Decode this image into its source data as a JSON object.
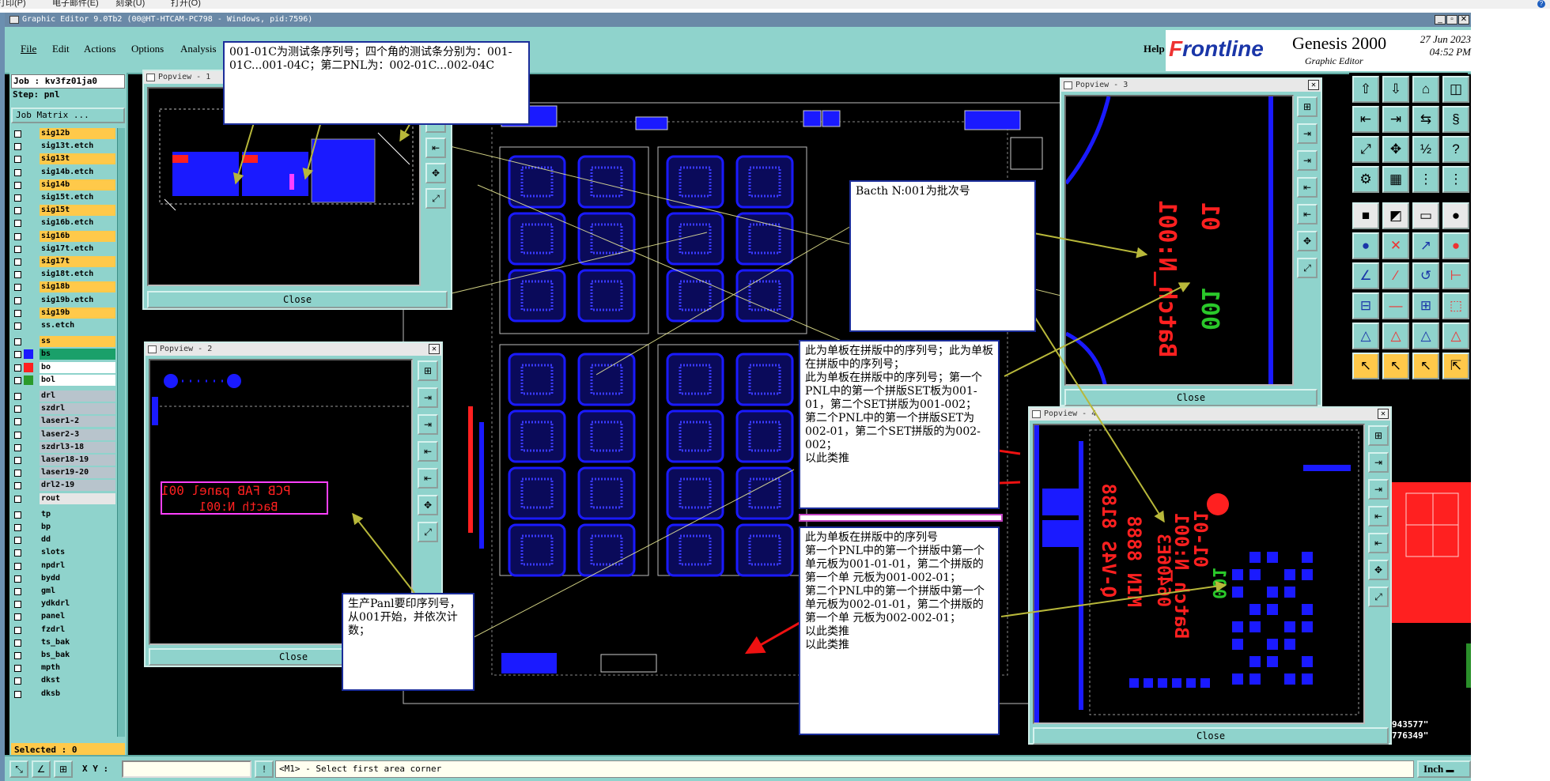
{
  "host_menu": [
    "打印(P)",
    "电子邮件(E)",
    "刻录(U)",
    "打开(O)"
  ],
  "window": {
    "title": "Graphic Editor 9.0Tb2 (00@HT-HTCAM-PC798 - Windows, pid:7596)"
  },
  "menu": {
    "items": [
      "File",
      "Edit",
      "Actions",
      "Options",
      "Analysis"
    ],
    "help": "Help"
  },
  "brand": {
    "logo_a": "F",
    "logo_b": "rontline",
    "product": "Genesis 2000",
    "subtitle": "Graphic Editor",
    "date": "27 Jun 2023",
    "time": "04:52 PM"
  },
  "job_panel": {
    "job": "Job : kv3fz01ja0",
    "step": "Step: pnl",
    "job_matrix": "Job Matrix ...",
    "selected": "Selected : 0"
  },
  "layers": [
    {
      "name": "sig12b",
      "color": "#ffc94a"
    },
    {
      "name": "sig13t.etch",
      "color": "#8fd3cc"
    },
    {
      "name": "sig13t",
      "color": "#ffc94a"
    },
    {
      "name": "sig14b.etch",
      "color": "#8fd3cc"
    },
    {
      "name": "sig14b",
      "color": "#ffc94a"
    },
    {
      "name": "sig15t.etch",
      "color": "#8fd3cc"
    },
    {
      "name": "sig15t",
      "color": "#ffc94a"
    },
    {
      "name": "sig16b.etch",
      "color": "#8fd3cc"
    },
    {
      "name": "sig16b",
      "color": "#ffc94a"
    },
    {
      "name": "sig17t.etch",
      "color": "#8fd3cc"
    },
    {
      "name": "sig17t",
      "color": "#ffc94a"
    },
    {
      "name": "sig18t.etch",
      "color": "#8fd3cc"
    },
    {
      "name": "sig18b",
      "color": "#ffc94a"
    },
    {
      "name": "sig19b.etch",
      "color": "#8fd3cc"
    },
    {
      "name": "sig19b",
      "color": "#ffc94a"
    },
    {
      "name": "ss.etch",
      "color": "#8fd3cc"
    },
    {
      "name": "ss",
      "color": "#ffc94a"
    },
    {
      "name": "bs",
      "color": "#1aa06a"
    },
    {
      "name": "bo",
      "color": "#ffffff"
    },
    {
      "name": "bol",
      "color": "#ffffff"
    },
    {
      "name": "drl",
      "color": "#b8c4cc"
    },
    {
      "name": "szdrl",
      "color": "#b8c4cc"
    },
    {
      "name": "laser1-2",
      "color": "#b8c4cc"
    },
    {
      "name": "laser2-3",
      "color": "#b8c4cc"
    },
    {
      "name": "szdrl3-18",
      "color": "#b8c4cc"
    },
    {
      "name": "laser18-19",
      "color": "#b8c4cc"
    },
    {
      "name": "laser19-20",
      "color": "#b8c4cc"
    },
    {
      "name": "drl2-19",
      "color": "#b8c4cc"
    },
    {
      "name": "rout",
      "color": "#e6e6e6"
    },
    {
      "name": "tp",
      "color": "#8fd3cc"
    },
    {
      "name": "bp",
      "color": "#8fd3cc"
    },
    {
      "name": "dd",
      "color": "#8fd3cc"
    },
    {
      "name": "slots",
      "color": "#8fd3cc"
    },
    {
      "name": "npdrl",
      "color": "#8fd3cc"
    },
    {
      "name": "bydd",
      "color": "#8fd3cc"
    },
    {
      "name": "gml",
      "color": "#8fd3cc"
    },
    {
      "name": "ydkdrl",
      "color": "#8fd3cc"
    },
    {
      "name": "panel",
      "color": "#8fd3cc"
    },
    {
      "name": "fzdrl",
      "color": "#8fd3cc"
    },
    {
      "name": "ts_bak",
      "color": "#8fd3cc"
    },
    {
      "name": "bs_bak",
      "color": "#8fd3cc"
    },
    {
      "name": "mpth",
      "color": "#8fd3cc"
    },
    {
      "name": "dkst",
      "color": "#8fd3cc"
    },
    {
      "name": "dksb",
      "color": "#8fd3cc"
    }
  ],
  "statusbar": {
    "xy_label": "X Y :",
    "xy_value": "",
    "command": "<M1> - Select first area corner",
    "units": "Inch"
  },
  "coords": {
    "x": "943577\"",
    "y": "776349\""
  },
  "popviews": [
    {
      "title": "Popview - 1",
      "close": "Close"
    },
    {
      "title": "Popview - 2",
      "close": "Close",
      "label_a": "PCB FAB panel 001",
      "label_b": "Bacth N:001"
    },
    {
      "title": "Popview - 3",
      "close": "Close",
      "text_a": "Batch_N:001",
      "text_b": "01",
      "text_c": "001"
    },
    {
      "title": "Popview - 4",
      "close": "Close",
      "text_a": "Batch_N:001",
      "text_b": "01-01",
      "text_c": "001",
      "text_d": "06406E3",
      "text_e": "Q-V4S 8188",
      "text_f": "MIN 8888"
    }
  ],
  "notes": {
    "n1": "001-01C为测试条序列号；四个角的测试条分别为：001-01C...001-04C；第二PNL为：002-01C...002-04C",
    "n2": "Bacth N:001为批次号",
    "n3": "此为单板在拼版中的序列号；此为单板在拼版中的序列号；\n此为单板在拼版中的序列号；第一个PNL中的第一个拼版SET板为001-01，第二个SET拼版为001-002；\n第二个PNL中的第一个拼版SET为002-01，第二个SET拼版的为002-002；\n以此类推",
    "n4": "此为单板在拼版中的序列号\n第一个PNL中的第一个拼版中第一个单元板为001-01-01，第二个拼版的第一个单 元板为001-002-01；\n第二个PNL中的第一个拼版中第一个单元板为002-01-01，第二个拼版的第一个单 元板为002-002-01；\n以此类推\n以此类推",
    "n5": "生产Panl要印序列号，从001开始，并依次计数；"
  },
  "toolbar_icons": [
    "import-icon",
    "export-icon",
    "home-icon",
    "split-icon",
    "step-in-icon",
    "step-out-icon",
    "swap-icon",
    "s-curve-icon",
    "fit-icon",
    "zoom-icon",
    "ratio-icon",
    "help-icon",
    "measure-icon",
    "grid-icon",
    "snap-icon",
    "layers-icon",
    "add-pad-icon",
    "add-line-icon",
    "add-text-icon",
    "add-circle-icon",
    "connect-icon",
    "cross-icon",
    "route-icon",
    "net-icon",
    "angle-icon",
    "diagonal-icon",
    "arc-icon",
    "pattern-icon",
    "edit-pad-icon",
    "edit-line-icon",
    "edit-symbol-icon",
    "shapes-icon",
    "triangle-a-icon",
    "triangle-b-icon",
    "triangle-c-icon",
    "triangle-d-icon",
    "pointer-icon",
    "select-icon",
    "move-icon",
    "transform-icon"
  ],
  "colors": {
    "panel_bg": "#8fd3cc",
    "board_blue": "#1a1aff",
    "silk_red": "#ff2020",
    "annotation_border": "#1b2d9a",
    "highlight_yellow": "#ffc94a"
  }
}
